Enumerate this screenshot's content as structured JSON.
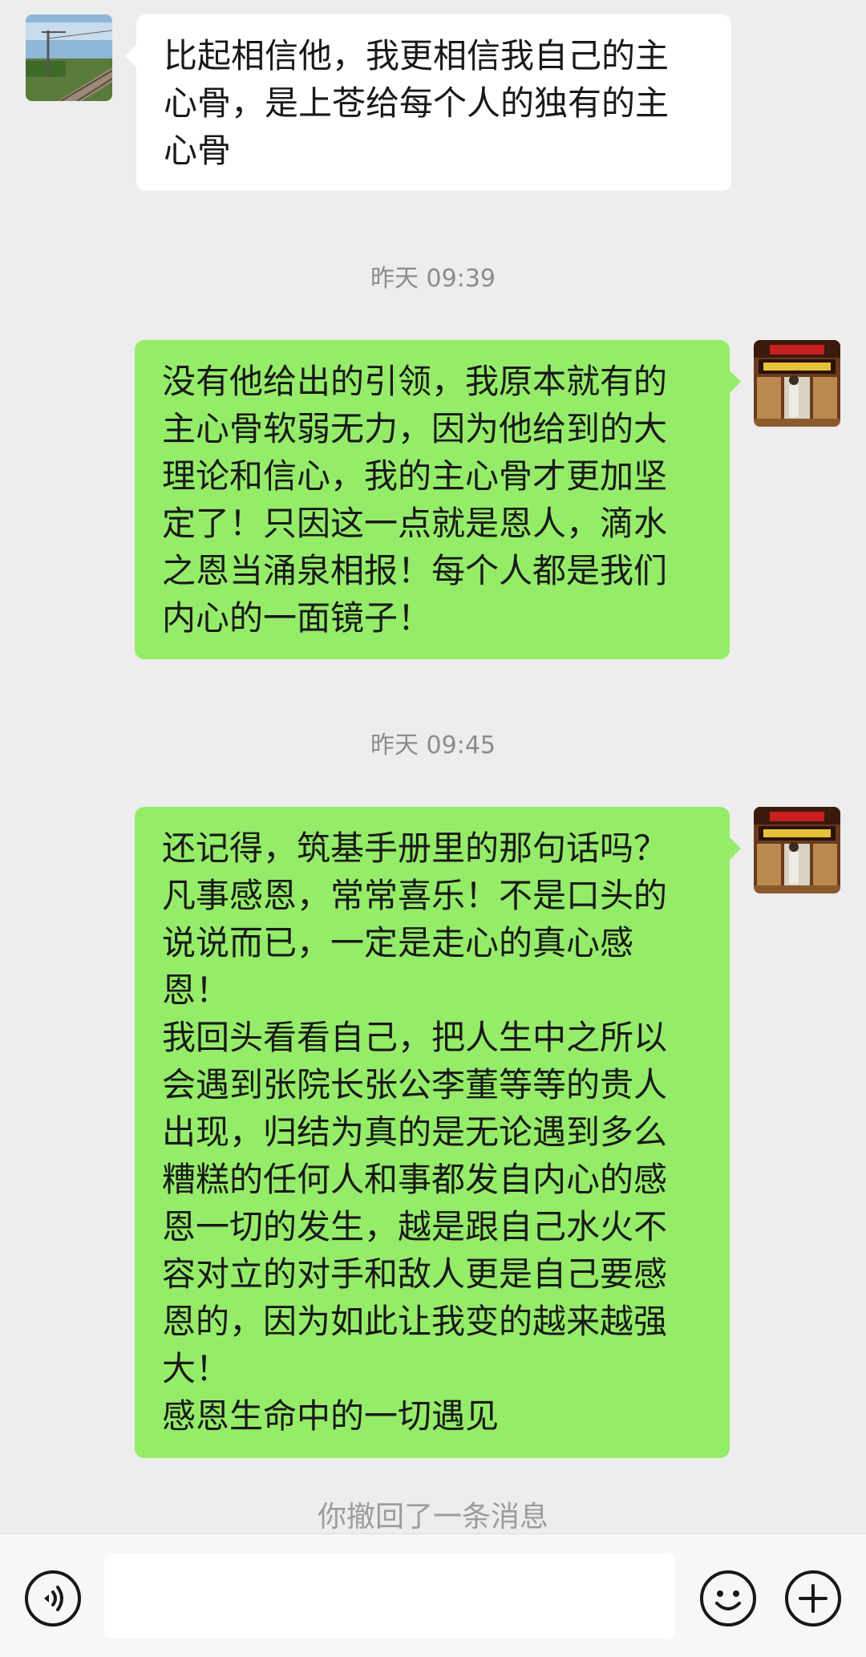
{
  "messages": [
    {
      "side": "left",
      "text": "比起相信他，我更相信我自己的主\n心骨，是上苍给每个人的独有的主\n心骨",
      "avatar": "railway-landscape"
    },
    {
      "side": "right",
      "text": "没有他给出的引领，我原本就有的\n主心骨软弱无力，因为他给到的大\n理论和信心，我的主心骨才更加坚\n定了！只因这一点就是恩人，滴水\n之恩当涌泉相报！每个人都是我们\n内心的一面镜子！",
      "avatar": "lecture-hall-photo"
    },
    {
      "side": "right",
      "text": "还记得，筑基手册里的那句话吗？\n凡事感恩，常常喜乐！不是口头的\n说说而已，一定是走心的真心感\n恩！\n我回头看看自己，把人生中之所以\n会遇到张院长张公李董等等的贵人\n出现，归结为真的是无论遇到多么\n糟糕的任何人和事都发自内心的感\n恩一切的发生，越是跟自己水火不\n容对立的对手和敌人更是自己要感\n恩的，因为如此让我变的越来越强\n大！\n感恩生命中的一切遇见",
      "avatar": "lecture-hall-photo"
    }
  ],
  "timestamps": [
    "昨天 09:39",
    "昨天 09:45"
  ],
  "recall_notice": "你撤回了一条消息",
  "input_bar": {
    "voice_icon": "voice-icon",
    "emoji_icon": "emoji-icon",
    "plus_icon": "plus-icon",
    "input_value": ""
  },
  "colors": {
    "background": "#ededed",
    "bubble_self": "#95ec69",
    "bubble_other": "#ffffff",
    "timestamp": "#8c8c8c"
  }
}
